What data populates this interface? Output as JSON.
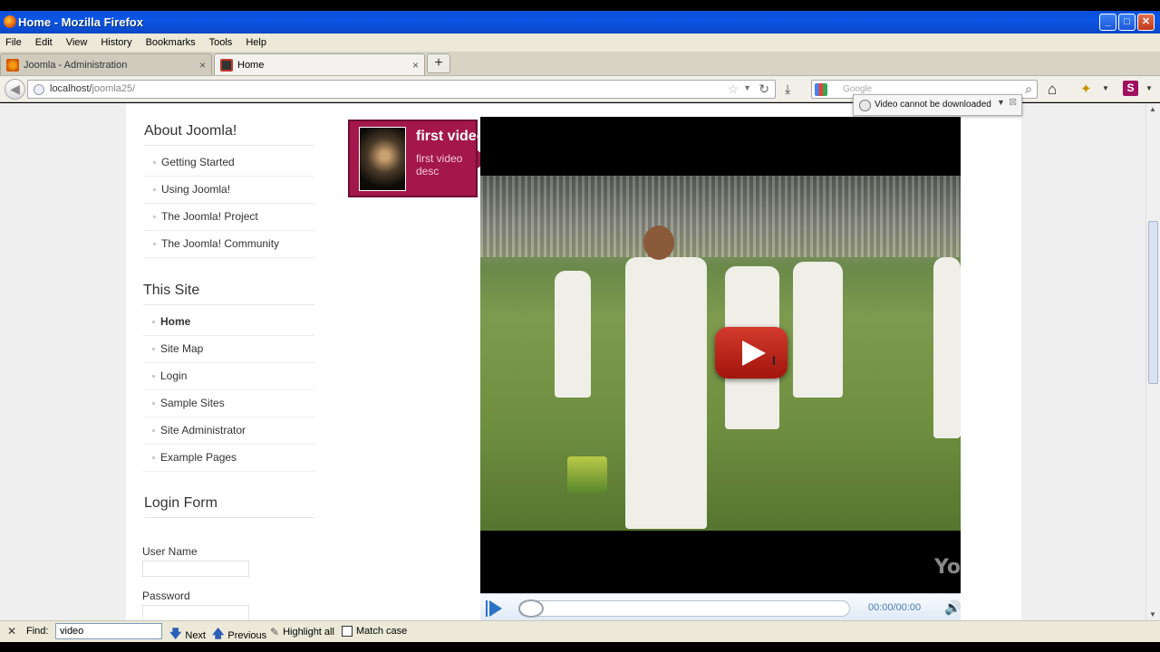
{
  "window": {
    "title": "Home - Mozilla Firefox"
  },
  "menubar": {
    "items": [
      "File",
      "Edit",
      "View",
      "History",
      "Bookmarks",
      "Tools",
      "Help"
    ]
  },
  "tabs": [
    {
      "label": "Joomla - Administration",
      "active": false
    },
    {
      "label": "Home",
      "active": true
    }
  ],
  "navbar": {
    "url_host": "localhost/",
    "url_path": "joomla25/",
    "search_placeholder": "Google"
  },
  "video_popup": {
    "text": "Video cannot be downloaded"
  },
  "sidebar": {
    "about": {
      "title": "About Joomla!",
      "items": [
        "Getting Started",
        "Using Joomla!",
        "The Joomla! Project",
        "The Joomla! Community"
      ]
    },
    "this_site": {
      "title": "This Site",
      "items": [
        "Home",
        "Site Map",
        "Login",
        "Sample Sites",
        "Site Administrator",
        "Example Pages"
      ],
      "current": "Home"
    },
    "login": {
      "title": "Login Form",
      "username_label": "User Name",
      "password_label": "Password"
    }
  },
  "video_card": {
    "title": "first video",
    "description": "first video desc"
  },
  "player": {
    "time": "00:00/00:00",
    "watermark": "Yo"
  },
  "findbar": {
    "label": "Find:",
    "value": "video",
    "next": "Next",
    "previous": "Previous",
    "highlight": "Highlight all",
    "match_case": "Match case"
  },
  "colors": {
    "card": "#a3174a",
    "titlebar": "#0b56e6",
    "play_button": "#c4241a"
  }
}
